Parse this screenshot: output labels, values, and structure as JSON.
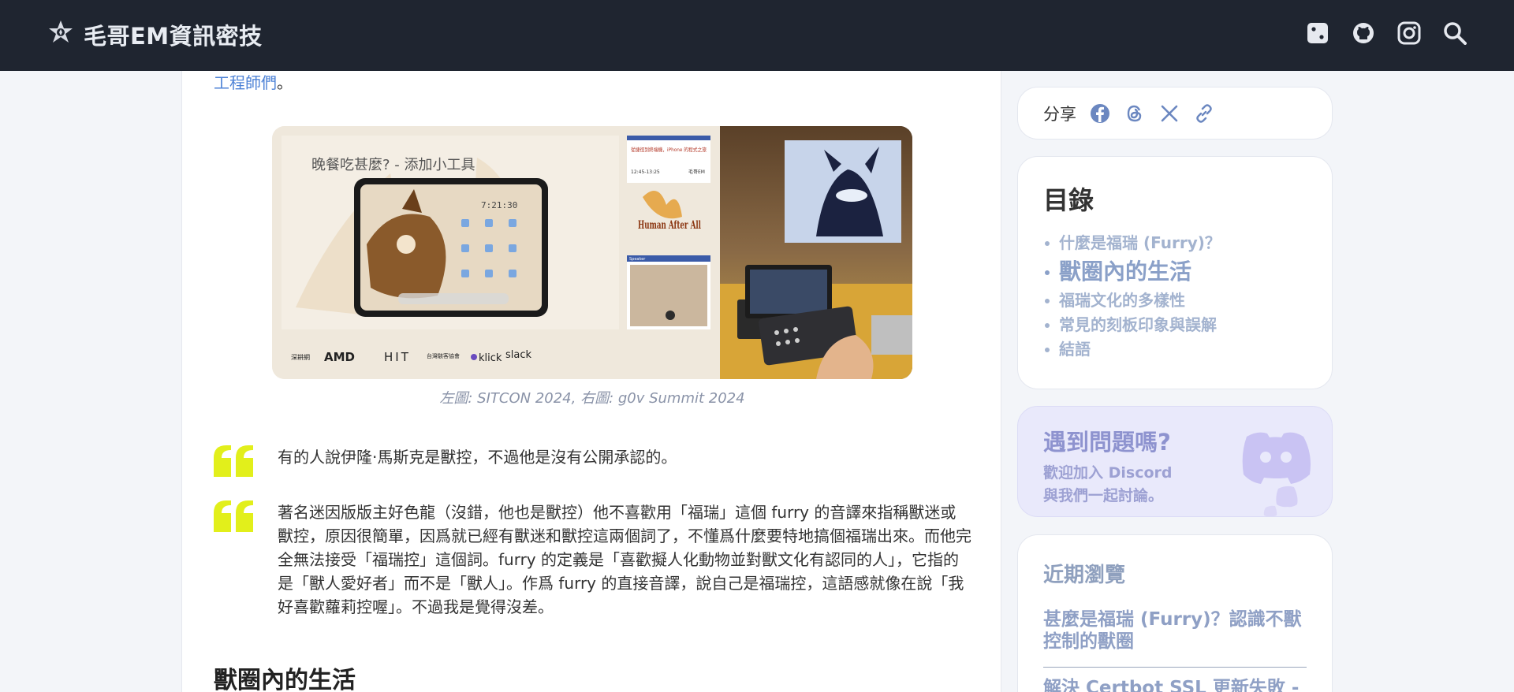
{
  "header": {
    "site_name": "毛哥EM資訊密技",
    "icons": [
      "dice-icon",
      "github-icon",
      "instagram-icon",
      "search-icon"
    ]
  },
  "article": {
    "link_text": "工程師們",
    "link_suffix": "。",
    "figure": {
      "widget_title": "晚餐吃甚麼? - 添加小工具",
      "clock": "7:21:30",
      "slide_title": "從捷徑到終端機，iPhone 的程式之旅",
      "slide_time": "12:45-13:25",
      "slide_speaker": "毛哥EM",
      "event_logo": "Human After All",
      "speaker_label": "Speaker",
      "sponsors": [
        "深耕網",
        "AMD",
        "HIT",
        "台灣駭客協會",
        "klick",
        "slack"
      ]
    },
    "caption": "左圖: SITCON 2024, 右圖: g0v Summit 2024",
    "quotes": [
      "有的人說伊隆·馬斯克是獸控，不過他是沒有公開承認的。",
      "著名迷因版版主好色龍（沒錯，他也是獸控）他不喜歡用「福瑞」這個 furry 的音譯來指稱獸迷或獸控，原因很簡單，因爲就已經有獸迷和獸控這兩個詞了，不懂爲什麼要特地搞個福瑞出來。而他完全無法接受「福瑞控」這個詞。furry 的定義是「喜歡擬人化動物並對獸文化有認同的人」，它指的是「獸人愛好者」而不是「獸人」。作爲 furry 的直接音譯，說自己是福瑞控，這語感就像在說「我好喜歡蘿莉控喔」。不過我是覺得沒差。"
    ],
    "section_heading": "獸圈內的生活"
  },
  "sidebar": {
    "share": {
      "label": "分享",
      "icons": [
        "facebook-icon",
        "threads-icon",
        "x-icon",
        "link-icon"
      ]
    },
    "toc": {
      "title": "目錄",
      "items": [
        {
          "label": "什麼是福瑞 (Furry)？",
          "active": false
        },
        {
          "label": "獸圈內的生活",
          "active": true
        },
        {
          "label": "福瑞文化的多樣性",
          "active": false
        },
        {
          "label": "常見的刻板印象與誤解",
          "active": false
        },
        {
          "label": "結語",
          "active": false
        }
      ]
    },
    "discord": {
      "title": "遇到問題嗎?",
      "line1": "歡迎加入 Discord",
      "line2": "與我們一起討論。"
    },
    "recent": {
      "title": "近期瀏覽",
      "items": [
        "甚麼是福瑞 (Furry)？認識不獸控制的獸圈",
        "解決 Certbot SSL 更新失敗 -"
      ]
    }
  },
  "colors": {
    "header_bg": "#1f2530",
    "quote_mark": "#e2ef1b",
    "link": "#4d82d6",
    "toc_text": "#a3b3cf"
  }
}
